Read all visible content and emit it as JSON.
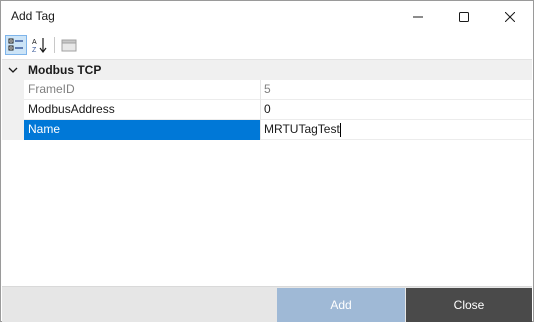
{
  "window": {
    "title": "Add Tag",
    "controls": [
      "minimize-icon",
      "maximize-icon",
      "close-icon"
    ]
  },
  "toolbar": {
    "buttons": [
      {
        "icon": "categorized-icon",
        "active": true
      },
      {
        "icon": "sort-alphabetical-icon",
        "active": false
      },
      {
        "icon": "property-pages-icon",
        "active": false,
        "disabled": true
      }
    ]
  },
  "grid": {
    "category": {
      "label": "Modbus TCP",
      "expanded": true,
      "icon": "chevron-down-icon"
    },
    "rows": [
      {
        "name": "FrameID",
        "value": "5",
        "readonly": true
      },
      {
        "name": "ModbusAddress",
        "value": "0",
        "readonly": false
      },
      {
        "name": "Name",
        "value": "MRTUTagTest",
        "readonly": false,
        "selected": true
      }
    ]
  },
  "footer": {
    "add_label": "Add",
    "close_label": "Close"
  },
  "colors": {
    "selection": "#0078d7",
    "add_button": "#9fb9d6",
    "close_button": "#4a4a4a"
  }
}
